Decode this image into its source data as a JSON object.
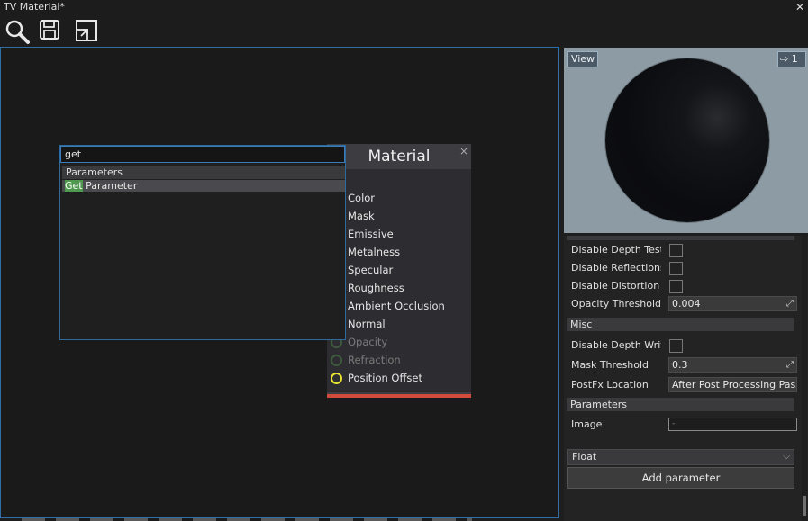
{
  "window": {
    "title": "TV Material*",
    "close_icon": "close-icon"
  },
  "toolbar": {
    "icons": [
      "search-icon",
      "save-icon",
      "fit-view-icon"
    ]
  },
  "search": {
    "query": "get",
    "group_label": "Parameters",
    "result_highlight": "Get",
    "result_rest": " Parameter"
  },
  "node": {
    "title": "Material",
    "close": "×",
    "pins": [
      {
        "label": "Color",
        "enabled": true,
        "connector": false
      },
      {
        "label": "Mask",
        "enabled": true,
        "connector": false
      },
      {
        "label": "Emissive",
        "enabled": true,
        "connector": false
      },
      {
        "label": "Metalness",
        "enabled": true,
        "connector": false
      },
      {
        "label": "Specular",
        "enabled": true,
        "connector": false
      },
      {
        "label": "Roughness",
        "enabled": true,
        "connector": false
      },
      {
        "label": "Ambient Occlusion",
        "enabled": true,
        "connector": false
      },
      {
        "label": "Normal",
        "enabled": true,
        "connector": false
      },
      {
        "label": "Opacity",
        "enabled": false,
        "connector": true
      },
      {
        "label": "Refraction",
        "enabled": false,
        "connector": true
      },
      {
        "label": "Position Offset",
        "enabled": true,
        "connector": true
      }
    ],
    "accent": "#d24b3c"
  },
  "preview": {
    "view_label": "View",
    "camera_label": "1"
  },
  "properties": {
    "rows_top": [
      {
        "label": "Disable Depth Test",
        "type": "checkbox"
      },
      {
        "label": "Disable Reflections",
        "type": "checkbox"
      },
      {
        "label": "Disable Distortion",
        "type": "checkbox"
      },
      {
        "label": "Opacity Threshold",
        "type": "number",
        "value": "0.004"
      }
    ],
    "misc_header": "Misc",
    "rows_misc": [
      {
        "label": "Disable Depth Write",
        "type": "checkbox"
      },
      {
        "label": "Mask Threshold",
        "type": "number",
        "value": "0.3"
      },
      {
        "label": "PostFx Location",
        "type": "select",
        "value": "After Post Processing Pass"
      }
    ],
    "params_header": "Parameters",
    "image_label": "Image",
    "image_value": "-",
    "type_select": "Float",
    "add_button": "Add parameter"
  }
}
